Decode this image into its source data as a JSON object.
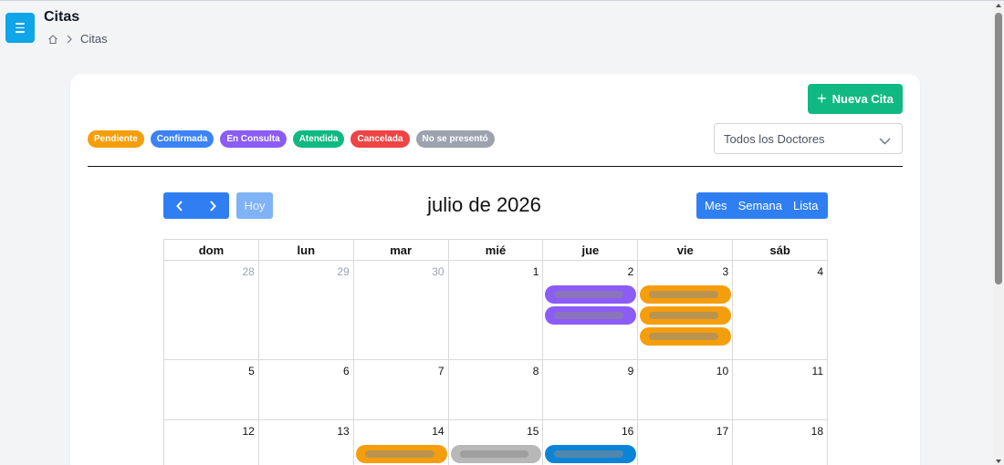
{
  "header": {
    "title": "Citas",
    "breadcrumb_current": "Citas"
  },
  "toolbar": {
    "new_button_label": "Nueva Cita"
  },
  "legend": [
    {
      "label": "Pendiente",
      "color": "#f59e0b"
    },
    {
      "label": "Confirmada",
      "color": "#3b82f6"
    },
    {
      "label": "En Consulta",
      "color": "#8b5cf6"
    },
    {
      "label": "Atendida",
      "color": "#10b981"
    },
    {
      "label": "Cancelada",
      "color": "#ef4444"
    },
    {
      "label": "No se presentó",
      "color": "#9ca3af"
    }
  ],
  "doctor_filter": {
    "selected": "Todos los Doctores"
  },
  "calendar": {
    "title": "julio de 2026",
    "today_label": "Hoy",
    "views": [
      "Mes",
      "Semana",
      "Lista"
    ],
    "weekdays": [
      "dom",
      "lun",
      "mar",
      "mié",
      "jue",
      "vie",
      "sáb"
    ],
    "weeks": [
      [
        {
          "day": "28",
          "other": true,
          "events": []
        },
        {
          "day": "29",
          "other": true,
          "events": []
        },
        {
          "day": "30",
          "other": true,
          "events": []
        },
        {
          "day": "1",
          "events": []
        },
        {
          "day": "2",
          "events": [
            "#8b5cf6",
            "#8b5cf6"
          ]
        },
        {
          "day": "3",
          "events": [
            "#f59e0b",
            "#f59e0b",
            "#f59e0b"
          ]
        },
        {
          "day": "4",
          "events": []
        }
      ],
      [
        {
          "day": "5",
          "events": []
        },
        {
          "day": "6",
          "events": []
        },
        {
          "day": "7",
          "events": []
        },
        {
          "day": "8",
          "events": []
        },
        {
          "day": "9",
          "events": []
        },
        {
          "day": "10",
          "events": []
        },
        {
          "day": "11",
          "events": []
        }
      ],
      [
        {
          "day": "12",
          "events": []
        },
        {
          "day": "13",
          "events": []
        },
        {
          "day": "14",
          "events": [
            "#f59e0b"
          ]
        },
        {
          "day": "15",
          "events": [
            "#b8b8b8"
          ]
        },
        {
          "day": "16",
          "events": [
            "#0b84d8"
          ]
        },
        {
          "day": "17",
          "events": []
        },
        {
          "day": "18",
          "events": []
        }
      ]
    ]
  }
}
